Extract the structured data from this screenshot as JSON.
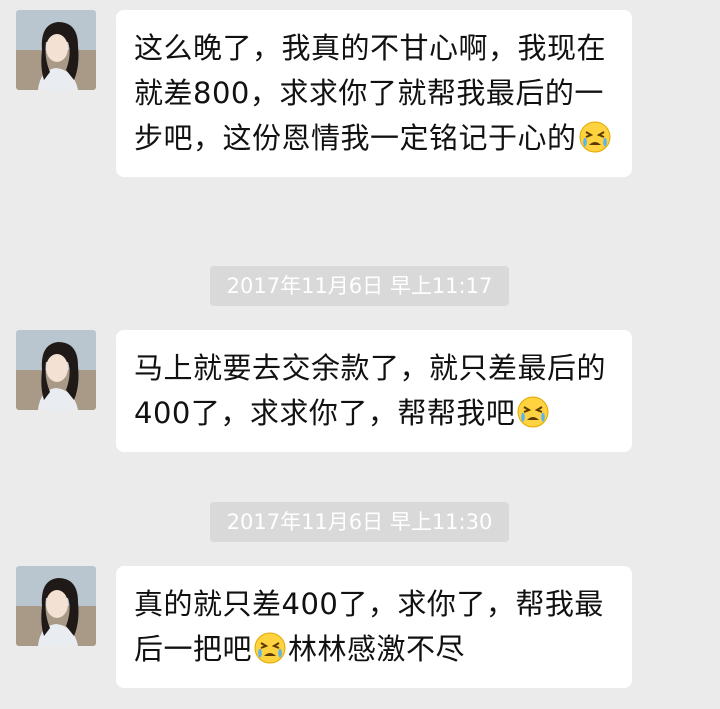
{
  "colors": {
    "background": "#ebebeb",
    "bubble": "#ffffff",
    "text": "#111111",
    "timestamp_bg": "#d9d9d9",
    "timestamp_text": "#ffffff"
  },
  "messages": [
    {
      "segments": [
        "这么晚了，我真的不甘心啊，我现在就差800，求求你了就帮我最后的一步吧，这份恩情我一定铭记于心的"
      ],
      "emoji": "crying-face-icon"
    },
    {
      "segments": [
        "马上就要去交余款了，就只差最后的400了，求求你了，帮帮我吧"
      ],
      "emoji": "crying-face-icon"
    },
    {
      "segments": [
        "真的就只差400了，求你了，帮我最后一把吧",
        "林林感激不尽"
      ],
      "emoji": "crying-face-icon"
    }
  ],
  "timestamps": [
    "2017年11月6日 早上11:17",
    "2017年11月6日 早上11:30"
  ]
}
